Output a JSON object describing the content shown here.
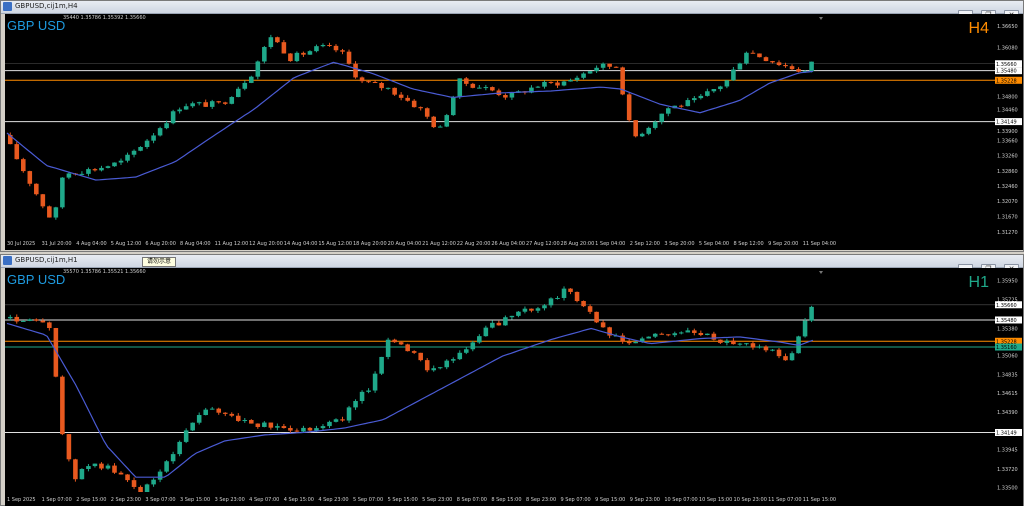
{
  "colors": {
    "bull": "#1fa98a",
    "bear": "#e8591f",
    "ma": "#4a5bd4",
    "hline": "#e0e0e0",
    "orange_line": "#ff8c00",
    "green_line": "#1fa98a",
    "tf_h4": "#ff8c00",
    "tf_h1": "#1fa98a"
  },
  "windows": {
    "h4": {
      "window_title": "GBPUSD,cij1m,H4",
      "symbol_label": "GBP USD",
      "ohlc_text": "35440 1.35786 1.35392 1.35660",
      "timeframe_label": "H4",
      "buttons": [
        "—",
        "❐",
        "✕"
      ]
    },
    "h1": {
      "window_title": "GBPUSD,cij1m,H1",
      "symbol_label": "GBP USD",
      "ohlc_text": "35570 1.35786 1.35521 1.35660",
      "timeframe_label": "H1",
      "tooltip_text": "请勿示意",
      "buttons": [
        "—",
        "❐",
        "✕"
      ]
    }
  },
  "chart_data": [
    {
      "type": "candlestick",
      "title": "GBPUSD,cij1m,H4",
      "ylim": [
        1.3116,
        1.3696
      ],
      "ytick_labels": [
        "1.36650",
        "1.36080",
        "1.35680",
        "1.35480",
        "1.35228",
        "1.34800",
        "1.34460",
        "1.34149",
        "1.33900",
        "1.33660",
        "1.33260",
        "1.32860",
        "1.32460",
        "1.32070",
        "1.31670",
        "1.31270"
      ],
      "ytick_values": [
        1.3665,
        1.3608,
        1.3568,
        1.3548,
        1.35228,
        1.348,
        1.3446,
        1.34149,
        1.339,
        1.3366,
        1.3326,
        1.3286,
        1.3246,
        1.3207,
        1.3167,
        1.3127
      ],
      "hlines": [
        {
          "value": 1.3548,
          "label": "1.35480",
          "color": "#e0e0e0"
        },
        {
          "value": 1.35228,
          "label": "1.35228",
          "color": "#ff8c00"
        },
        {
          "value": 1.34149,
          "label": "1.34149",
          "color": "#e0e0e0"
        }
      ],
      "price_tag": {
        "value": 1.3566,
        "label": "1.35660"
      },
      "xtick_labels": [
        "30 Jul 2025",
        "31 Jul 20:00",
        "4 Aug 04:00",
        "5 Aug 12:00",
        "6 Aug 20:00",
        "8 Aug 04:00",
        "11 Aug 12:00",
        "12 Aug 20:00",
        "14 Aug 04:00",
        "15 Aug 12:00",
        "18 Aug 20:00",
        "20 Aug 04:00",
        "21 Aug 12:00",
        "22 Aug 20:00",
        "26 Aug 04:00",
        "27 Aug 12:00",
        "28 Aug 20:00",
        "1 Sep 04:00",
        "2 Sep 12:00",
        "3 Sep 20:00",
        "5 Sep 04:00",
        "8 Sep 12:00",
        "9 Sep 20:00",
        "11 Sep 04:00"
      ],
      "ma_anchors": [
        [
          0,
          1.3385
        ],
        [
          0.04,
          1.33
        ],
        [
          0.09,
          1.3262
        ],
        [
          0.13,
          1.327
        ],
        [
          0.17,
          1.331
        ],
        [
          0.21,
          1.338
        ],
        [
          0.25,
          1.3448
        ],
        [
          0.29,
          1.353
        ],
        [
          0.33,
          1.357
        ],
        [
          0.37,
          1.354
        ],
        [
          0.41,
          1.35
        ],
        [
          0.45,
          1.3478
        ],
        [
          0.5,
          1.349
        ],
        [
          0.55,
          1.3495
        ],
        [
          0.6,
          1.3505
        ],
        [
          0.62,
          1.35
        ],
        [
          0.66,
          1.346
        ],
        [
          0.7,
          1.3438
        ],
        [
          0.74,
          1.347
        ],
        [
          0.77,
          1.3515
        ],
        [
          0.8,
          1.3542
        ],
        [
          0.814,
          1.3546
        ]
      ],
      "price_anchors": [
        [
          0,
          1.338
        ],
        [
          0.03,
          1.324
        ],
        [
          0.05,
          1.315
        ],
        [
          0.06,
          1.328
        ],
        [
          0.09,
          1.329
        ],
        [
          0.12,
          1.331
        ],
        [
          0.15,
          1.338
        ],
        [
          0.18,
          1.346
        ],
        [
          0.22,
          1.346
        ],
        [
          0.25,
          1.354
        ],
        [
          0.27,
          1.364
        ],
        [
          0.29,
          1.358
        ],
        [
          0.32,
          1.361
        ],
        [
          0.34,
          1.36
        ],
        [
          0.36,
          1.352
        ],
        [
          0.39,
          1.35
        ],
        [
          0.42,
          1.345
        ],
        [
          0.44,
          1.339
        ],
        [
          0.46,
          1.352
        ],
        [
          0.49,
          1.35
        ],
        [
          0.51,
          1.348
        ],
        [
          0.54,
          1.351
        ],
        [
          0.57,
          1.352
        ],
        [
          0.6,
          1.356
        ],
        [
          0.62,
          1.356
        ],
        [
          0.635,
          1.337
        ],
        [
          0.65,
          1.34
        ],
        [
          0.67,
          1.345
        ],
        [
          0.7,
          1.347
        ],
        [
          0.73,
          1.352
        ],
        [
          0.75,
          1.36
        ],
        [
          0.77,
          1.358
        ],
        [
          0.79,
          1.356
        ],
        [
          0.81,
          1.3545
        ],
        [
          0.816,
          1.3566
        ]
      ]
    },
    {
      "type": "candlestick",
      "title": "GBPUSD,cij1m,H1",
      "ylim": [
        1.33445,
        1.36095
      ],
      "ytick_labels": [
        "1.35950",
        "1.35725",
        "1.35480",
        "1.35380",
        "1.35228",
        "1.35060",
        "1.34835",
        "1.34615",
        "1.34390",
        "1.34149",
        "1.33945",
        "1.33720",
        "1.33500",
        "1.33275"
      ],
      "ytick_values": [
        1.3595,
        1.35725,
        1.3548,
        1.3538,
        1.35228,
        1.3506,
        1.34835,
        1.34615,
        1.3439,
        1.34149,
        1.33945,
        1.3372,
        1.335,
        1.33275
      ],
      "hlines": [
        {
          "value": 1.3548,
          "label": "1.35480",
          "color": "#e0e0e0"
        },
        {
          "value": 1.35228,
          "label": "1.35228",
          "color": "#ff8c00"
        },
        {
          "value": 1.3516,
          "label": "1.35160",
          "color": "#1fa98a"
        },
        {
          "value": 1.34149,
          "label": "1.34149",
          "color": "#e0e0e0"
        }
      ],
      "price_tag": {
        "value": 1.3566,
        "label": "1.35660"
      },
      "xtick_labels": [
        "1 Sep 2025",
        "1 Sep 07:00",
        "2 Sep 15:00",
        "2 Sep 23:00",
        "3 Sep 07:00",
        "3 Sep 15:00",
        "3 Sep 23:00",
        "4 Sep 07:00",
        "4 Sep 15:00",
        "4 Sep 23:00",
        "5 Sep 07:00",
        "5 Sep 15:00",
        "5 Sep 23:00",
        "8 Sep 07:00",
        "8 Sep 15:00",
        "8 Sep 23:00",
        "9 Sep 07:00",
        "9 Sep 15:00",
        "9 Sep 23:00",
        "10 Sep 07:00",
        "10 Sep 15:00",
        "10 Sep 23:00",
        "11 Sep 07:00",
        "11 Sep 15:00"
      ],
      "ma_anchors": [
        [
          0,
          1.3544
        ],
        [
          0.04,
          1.353
        ],
        [
          0.07,
          1.347
        ],
        [
          0.1,
          1.34
        ],
        [
          0.13,
          1.3362
        ],
        [
          0.16,
          1.3362
        ],
        [
          0.19,
          1.339
        ],
        [
          0.22,
          1.3405
        ],
        [
          0.26,
          1.3412
        ],
        [
          0.3,
          1.3415
        ],
        [
          0.34,
          1.342
        ],
        [
          0.38,
          1.343
        ],
        [
          0.42,
          1.3455
        ],
        [
          0.46,
          1.348
        ],
        [
          0.5,
          1.3505
        ],
        [
          0.55,
          1.3525
        ],
        [
          0.59,
          1.3538
        ],
        [
          0.62,
          1.3528
        ],
        [
          0.65,
          1.352
        ],
        [
          0.7,
          1.3526
        ],
        [
          0.74,
          1.3528
        ],
        [
          0.78,
          1.3522
        ],
        [
          0.8,
          1.3518
        ],
        [
          0.814,
          1.3524
        ]
      ],
      "price_anchors": [
        [
          0,
          1.355
        ],
        [
          0.03,
          1.3545
        ],
        [
          0.05,
          1.354
        ],
        [
          0.055,
          1.343
        ],
        [
          0.07,
          1.336
        ],
        [
          0.09,
          1.338
        ],
        [
          0.11,
          1.337
        ],
        [
          0.14,
          1.3345
        ],
        [
          0.16,
          1.337
        ],
        [
          0.18,
          1.341
        ],
        [
          0.2,
          1.344
        ],
        [
          0.22,
          1.344
        ],
        [
          0.25,
          1.3425
        ],
        [
          0.28,
          1.342
        ],
        [
          0.31,
          1.342
        ],
        [
          0.34,
          1.343
        ],
        [
          0.37,
          1.347
        ],
        [
          0.39,
          1.353
        ],
        [
          0.41,
          1.351
        ],
        [
          0.43,
          1.349
        ],
        [
          0.46,
          1.3505
        ],
        [
          0.49,
          1.354
        ],
        [
          0.52,
          1.3555
        ],
        [
          0.55,
          1.357
        ],
        [
          0.57,
          1.3585
        ],
        [
          0.59,
          1.356
        ],
        [
          0.61,
          1.353
        ],
        [
          0.63,
          1.352
        ],
        [
          0.66,
          1.353
        ],
        [
          0.69,
          1.3535
        ],
        [
          0.72,
          1.3525
        ],
        [
          0.75,
          1.352
        ],
        [
          0.78,
          1.351
        ],
        [
          0.795,
          1.35
        ],
        [
          0.805,
          1.354
        ],
        [
          0.816,
          1.3566
        ]
      ]
    }
  ]
}
